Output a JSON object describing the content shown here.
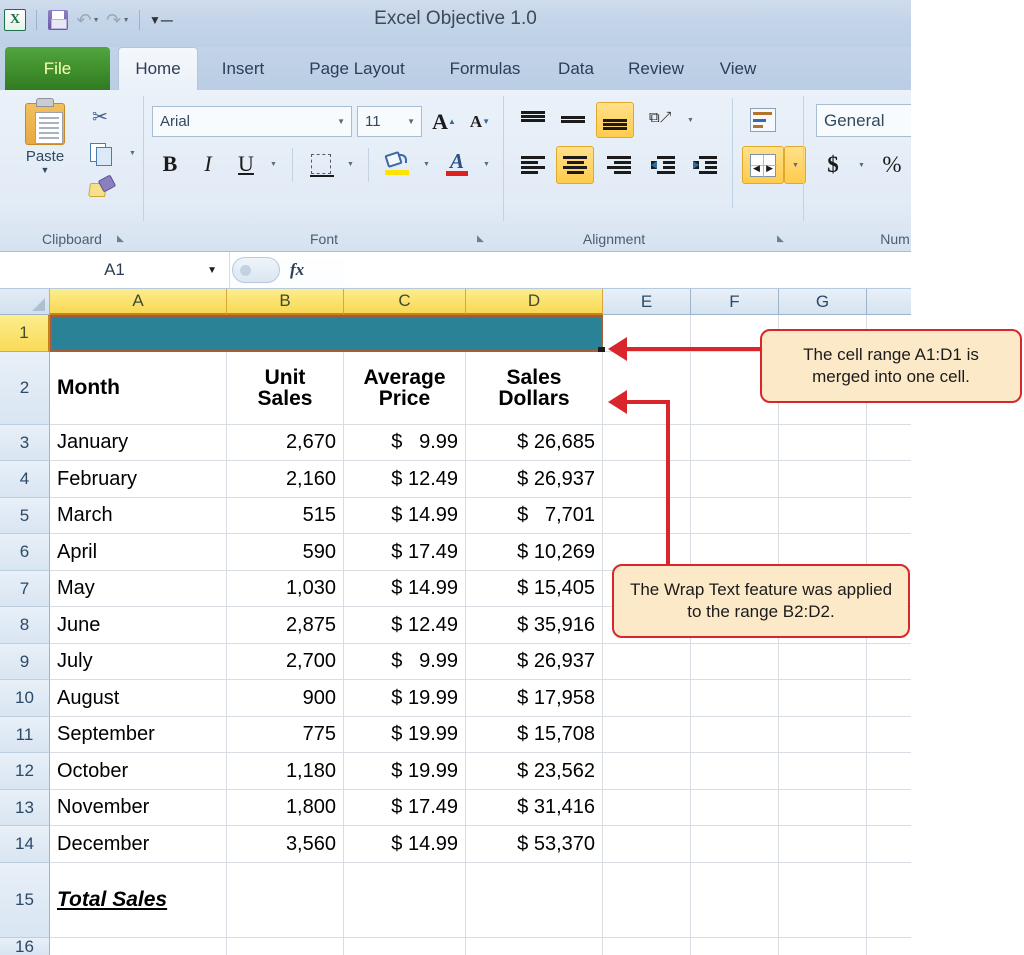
{
  "window": {
    "title": "Excel Objective 1.0"
  },
  "quick_access": {
    "logo": "excel-logo-icon",
    "buttons": [
      {
        "name": "save-icon",
        "label": "Save"
      },
      {
        "name": "undo-icon",
        "label": "Undo"
      },
      {
        "name": "redo-icon",
        "label": "Redo"
      },
      {
        "name": "customize-qat-icon",
        "label": "Customize Quick Access Toolbar"
      }
    ]
  },
  "tabs": {
    "file": "File",
    "items": [
      {
        "label": "Home",
        "active": true
      },
      {
        "label": "Insert",
        "active": false
      },
      {
        "label": "Page Layout",
        "active": false
      },
      {
        "label": "Formulas",
        "active": false
      },
      {
        "label": "Data",
        "active": false
      },
      {
        "label": "Review",
        "active": false
      },
      {
        "label": "View",
        "active": false
      }
    ]
  },
  "ribbon": {
    "clipboard": {
      "label": "Clipboard",
      "paste": "Paste",
      "cut": "Cut",
      "copy": "Copy",
      "format_painter": "Format Painter"
    },
    "font": {
      "label": "Font",
      "font_name": "Arial",
      "font_size": "11",
      "grow_font": "Grow Font",
      "shrink_font": "Shrink Font",
      "bold": "B",
      "italic": "I",
      "underline": "U",
      "borders": "Borders",
      "fill_color": "Fill Color",
      "font_color": "Font Color"
    },
    "alignment": {
      "label": "Alignment",
      "top_align": "Top Align",
      "middle_align": "Middle Align",
      "bottom_align": "Bottom Align",
      "orientation": "Orientation",
      "align_left": "Align Text Left",
      "align_center": "Center",
      "align_right": "Align Text Right",
      "decrease_indent": "Decrease Indent",
      "increase_indent": "Increase Indent",
      "wrap_text": "Wrap Text",
      "merge_center": "Merge & Center"
    },
    "number": {
      "label": "Num",
      "format": "General",
      "accounting": "$",
      "percent": "%"
    }
  },
  "formula_bar": {
    "name_box": "A1",
    "formula": ""
  },
  "sheet": {
    "columns": [
      "A",
      "B",
      "C",
      "D",
      "E",
      "F",
      "G"
    ],
    "selected_columns": [
      "A",
      "B",
      "C",
      "D"
    ],
    "row_numbers": [
      "1",
      "2",
      "3",
      "4",
      "5",
      "6",
      "7",
      "8",
      "9",
      "10",
      "11",
      "12",
      "13",
      "14",
      "15",
      "16"
    ],
    "selected_rows": [
      "1"
    ],
    "merged_cell": {
      "range": "A1:D1",
      "fill": "#2a8296",
      "value": ""
    },
    "headers_row2": {
      "a": "Month",
      "b": "Unit\nSales",
      "c": "Average\nPrice",
      "d": "Sales\nDollars"
    },
    "rows": [
      {
        "row": "3",
        "month": "January",
        "unit_sales": "2,670",
        "avg_price": "$   9.99",
        "sales_dollars": "$ 26,685"
      },
      {
        "row": "4",
        "month": "February",
        "unit_sales": "2,160",
        "avg_price": "$ 12.49",
        "sales_dollars": "$ 26,937"
      },
      {
        "row": "5",
        "month": "March",
        "unit_sales": "515",
        "avg_price": "$ 14.99",
        "sales_dollars": "$   7,701"
      },
      {
        "row": "6",
        "month": "April",
        "unit_sales": "590",
        "avg_price": "$ 17.49",
        "sales_dollars": "$ 10,269"
      },
      {
        "row": "7",
        "month": "May",
        "unit_sales": "1,030",
        "avg_price": "$ 14.99",
        "sales_dollars": "$ 15,405"
      },
      {
        "row": "8",
        "month": "June",
        "unit_sales": "2,875",
        "avg_price": "$ 12.49",
        "sales_dollars": "$ 35,916"
      },
      {
        "row": "9",
        "month": "July",
        "unit_sales": "2,700",
        "avg_price": "$   9.99",
        "sales_dollars": "$ 26,937"
      },
      {
        "row": "10",
        "month": "August",
        "unit_sales": "900",
        "avg_price": "$ 19.99",
        "sales_dollars": "$ 17,958"
      },
      {
        "row": "11",
        "month": "September",
        "unit_sales": "775",
        "avg_price": "$ 19.99",
        "sales_dollars": "$ 15,708"
      },
      {
        "row": "12",
        "month": "October",
        "unit_sales": "1,180",
        "avg_price": "$ 19.99",
        "sales_dollars": "$ 23,562"
      },
      {
        "row": "13",
        "month": "November",
        "unit_sales": "1,800",
        "avg_price": "$ 17.49",
        "sales_dollars": "$ 31,416"
      },
      {
        "row": "14",
        "month": "December",
        "unit_sales": "3,560",
        "avg_price": "$ 14.99",
        "sales_dollars": "$ 53,370"
      }
    ],
    "total_row": {
      "row": "15",
      "label": "Total Sales",
      "unit_sales": "",
      "avg_price": "",
      "sales_dollars": ""
    }
  },
  "annotations": [
    {
      "id": "callout-merged",
      "text": "The cell range A1:D1 is merged into one cell."
    },
    {
      "id": "callout-wrap",
      "text": "The Wrap Text feature was applied to the range B2:D2."
    }
  ],
  "colors": {
    "merged_fill": "#2a8296",
    "callout_bg": "#fbe9c8",
    "callout_border": "#d8262c",
    "header_selected": "#fbe06a",
    "file_tab": "#3f8f2d"
  }
}
